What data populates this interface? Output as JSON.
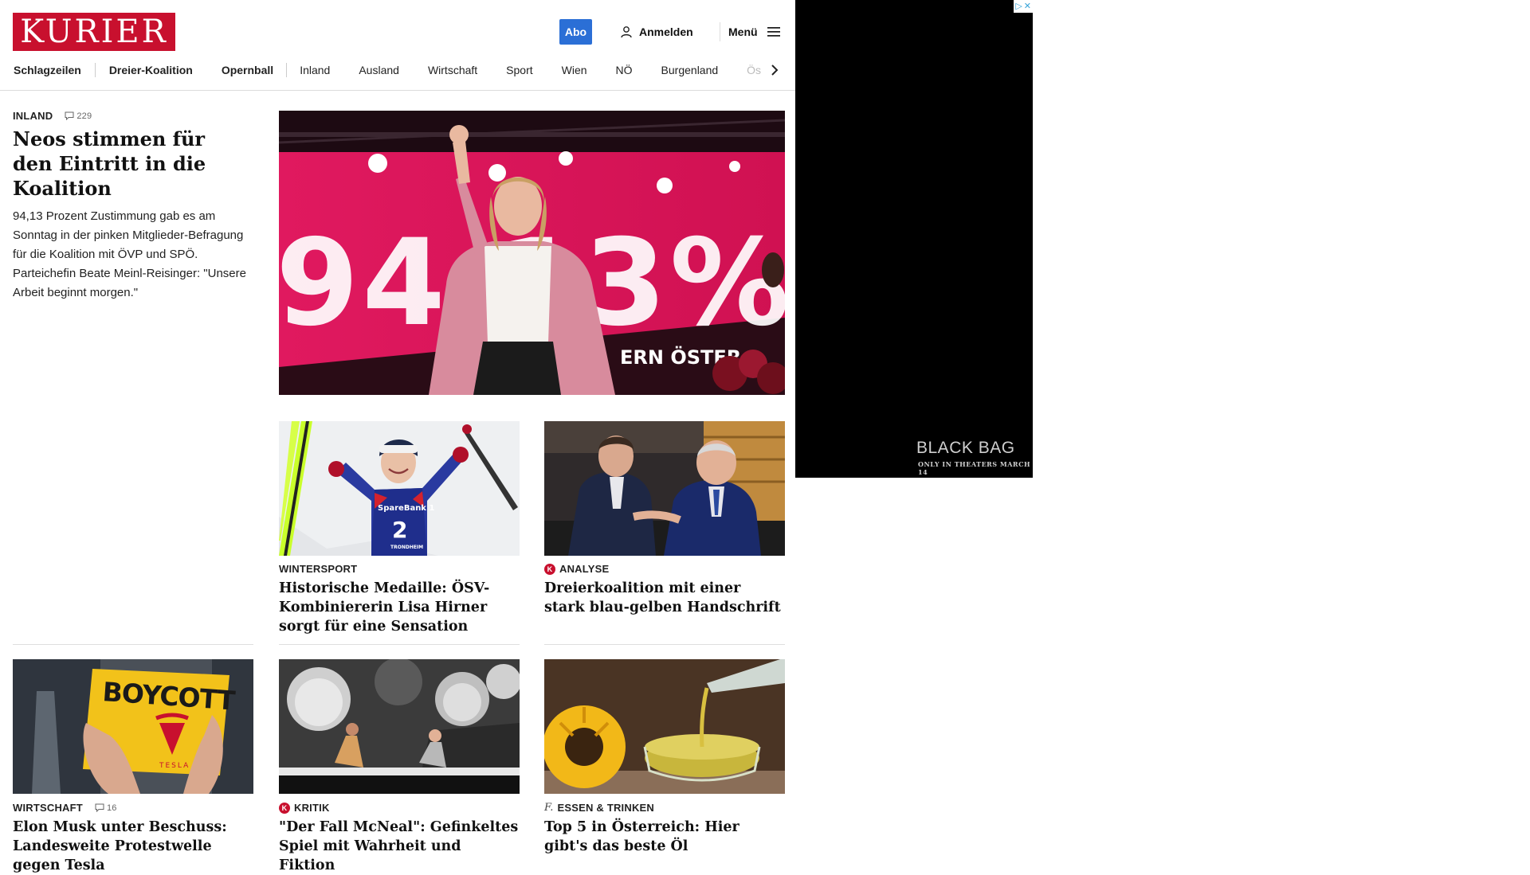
{
  "header": {
    "logo": "KURIER",
    "abo_label": "Abo",
    "login_label": "Anmelden",
    "menu_label": "Menü"
  },
  "nav": {
    "items": [
      "Schlagzeilen",
      "Dreier-Koalition",
      "Opernball",
      "Inland",
      "Ausland",
      "Wirtschaft",
      "Sport",
      "Wien",
      "NÖ",
      "Burgenland",
      "Ös"
    ]
  },
  "lead": {
    "kicker": "INLAND",
    "comments": "229",
    "headline": "Neos stimmen für den Eintritt in die Koalition",
    "teaser": "94,13 Prozent Zustimmung gab es am Sonntag in der pinken Mitglieder-Befragung für die Koalition mit ÖVP und SPÖ. Parteichefin Beate Meinl-Reisinger: \"Unsere Arbeit beginnt morgen.\"",
    "image_text": "94,13%",
    "image_banner": "ERN ÖSTER"
  },
  "articles": [
    {
      "kicker": "WINTERSPORT",
      "headline": "Historische Medaille: ÖSV-Kombiniererin Lisa Hirner sorgt für eine Sensation",
      "bib_sponsor": "SpareBank 1",
      "bib_number": "2",
      "bib_city": "TRONDHEIM"
    },
    {
      "kicker": "ANALYSE",
      "badge": "K",
      "headline": "Dreierkoalition mit einer stark blau-gelben Handschrift"
    },
    {
      "kicker": "WIRTSCHAFT",
      "comments": "16",
      "headline": "Elon Musk unter Beschuss: Landesweite Protestwelle gegen Tesla",
      "sign_text": "BOYCOTT",
      "sign_brand": "TESLA"
    },
    {
      "kicker": "KRITIK",
      "badge": "K",
      "headline": "\"Der Fall McNeal\": Gefinkeltes Spiel mit Wahrheit und Fiktion"
    },
    {
      "kicker": "ESSEN & TRINKEN",
      "badge": "f.",
      "headline": "Top 5 in Österreich: Hier gibt's das beste Öl"
    }
  ],
  "ad": {
    "title": "BLACK BAG",
    "subtitle": "ONLY IN THEATERS MARCH 14"
  },
  "colors": {
    "brand": "#c8102e",
    "abo": "#2b6fd6",
    "pink": "#e0195f"
  }
}
